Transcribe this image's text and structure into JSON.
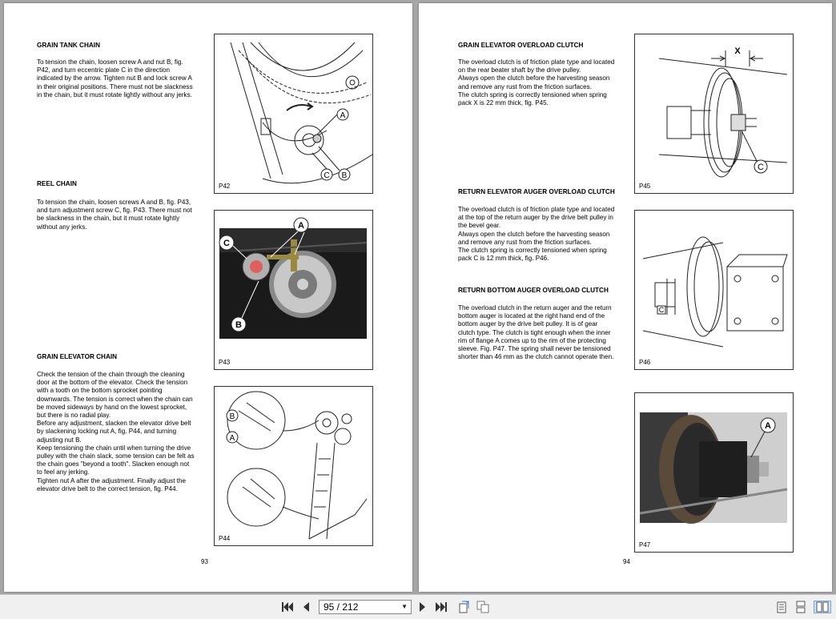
{
  "left_page": {
    "sections": [
      {
        "heading": "GRAIN TANK CHAIN",
        "body": "To tension the chain, loosen screw A and nut B, fig.\nP42, and turn eccentric plate C in the direction\nindicated by the arrow. Tighten nut B and lock screw A\nin their original positions. There must not be slackness\nin the chain, but it must rotate lightly without any jerks."
      },
      {
        "heading": "REEL CHAIN",
        "body": "To tension the chain, loosen screws A and B, fig. P43,\nand turn adjustment screw C, fig. P43. There must not\nbe slackness in the chain, but it must rotate lightly\nwithout any jerks."
      },
      {
        "heading": "GRAIN ELEVATOR CHAIN",
        "body": "Check the tension of the chain through the cleaning\ndoor at the bottom of the elevator. Check the tension\nwith a tooth on the bottom sprocket pointing\ndownwards. The tension is correct when the chain can\nbe moved sideways by hand on the lowest sprocket,\nbut there is no radial play.\nBefore any adjustment, slacken the elevator drive belt\nby slackening locking nut A, fig. P44, and turning\nadjusting nut B.\nKeep tensioning the chain until when turning the drive\npulley with the chain slack, some tension can be felt as\nthe chain goes \"beyond a tooth\". Slacken enough not\nto feel any jerking.\nTighten nut A after the adjustment. Finally adjust the\nelevator drive belt to the correct tension, fig. P44."
      }
    ],
    "figures": {
      "p42": {
        "label": "P42",
        "callouts": [
          "A",
          "B",
          "C"
        ]
      },
      "p43": {
        "label": "P43",
        "callouts": [
          "A",
          "B",
          "C"
        ]
      },
      "p44": {
        "label": "P44",
        "callouts": [
          "B",
          "A"
        ]
      }
    },
    "page_number": "93"
  },
  "right_page": {
    "sections": [
      {
        "heading": "GRAIN ELEVATOR OVERLOAD CLUTCH",
        "body": "The overload clutch is of friction plate type and located\non the rear beater shaft by the drive pulley.\nAlways open the clutch before the harvesting season\nand remove any rust from the friction surfaces.\nThe clutch spring is correctly tensioned when spring\npack X is 22 mm thick, fig. P45."
      },
      {
        "heading": "RETURN ELEVATOR AUGER OVERLOAD CLUTCH",
        "body": "The overload clutch is of friction plate type and located\nat the top of the return auger by the drive belt pulley in\nthe bevel gear.\nAlways open the clutch before the harvesting season\nand remove any rust from the friction surfaces.\nThe clutch spring is correctly tensioned when spring\npack C is 12 mm thick, fig. P46."
      },
      {
        "heading": "RETURN BOTTOM AUGER OVERLOAD CLUTCH",
        "body": "The overload clutch in the return auger and the return\nbottom auger is located at the right hand end of the\nbottom auger by the drive belt pulley. It is of gear\nclutch type. The clutch is tight enough when the inner\nrim of flange A comes up to the rim of the protecting\nsleeve. Fig. P47. The spring shall never be tensioned\nshorter than 46 mm as the clutch cannot operate then."
      }
    ],
    "figures": {
      "p45": {
        "label": "P45",
        "callouts": [
          "X",
          "C"
        ]
      },
      "p46": {
        "label": "P46",
        "callouts": [
          "C"
        ]
      },
      "p47": {
        "label": "P47",
        "callouts": [
          "A"
        ]
      }
    },
    "page_number": "94"
  },
  "toolbar": {
    "first_page_icon": "first-page-icon",
    "prev_page_icon": "previous-page-icon",
    "page_indicator": "95 / 212",
    "next_page_icon": "next-page-icon",
    "last_page_icon": "last-page-icon",
    "view_icons": [
      "single-page-view-icon",
      "continuous-view-icon",
      "two-page-view-icon"
    ]
  }
}
